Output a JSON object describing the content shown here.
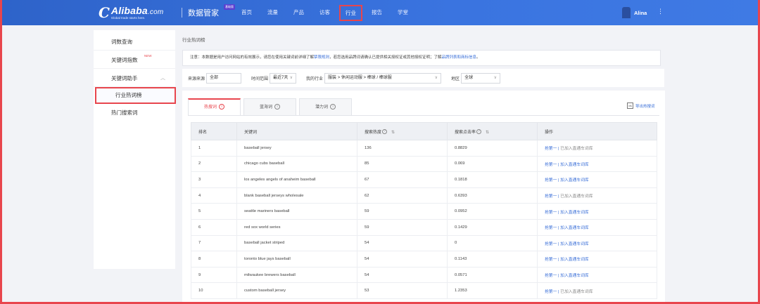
{
  "header": {
    "logo_mark": "C",
    "logo_word": "Alibaba",
    "logo_dotcom": ".com",
    "logo_tagline": "Global trade starts here.",
    "product": "数据管家",
    "product_badge": "基础版",
    "nav": [
      "首页",
      "流量",
      "产品",
      "访客",
      "行业",
      "报告",
      "学堂"
    ],
    "active_nav": "行业",
    "user_name": "Alina",
    "more_icon": "⋮"
  },
  "sidebar": {
    "items": [
      {
        "label": "词数查询"
      },
      {
        "label": "关键词指数",
        "badge": "NEW"
      },
      {
        "label": "关键词助手",
        "chevron": "︿"
      }
    ],
    "sub_items": [
      {
        "label": "行业热词榜",
        "active": true
      },
      {
        "label": "热门搜索词",
        "active": false
      }
    ]
  },
  "main": {
    "breadcrumb": "行业热词榜",
    "notice": {
      "text_before": "注意：本数据是用户访问网站的有效展示，请您在使用关键词前详细了解",
      "link1": "禁限规则",
      "text_middle": "，若您选用品牌词请确认已提供相关授权证或其他授权证明；了解",
      "link2": "品牌列表和商标信息",
      "text_after": "。"
    },
    "filters": {
      "source_label": "来源来源",
      "source_value": "全部",
      "time_label": "时间范围",
      "time_value": "最近7天",
      "industry_label": "我的行业",
      "industry_value": "服装 > 休闲运动服 > 棒球 / 棒球服",
      "region_label": "地区",
      "region_value": "全球",
      "caret": "∨"
    },
    "tabs": [
      {
        "label": "热搜词",
        "active": true
      },
      {
        "label": "蓝海词",
        "active": false
      },
      {
        "label": "潜力词",
        "active": false
      }
    ],
    "tab_info_icon": "i",
    "export_label": "导出热搜词",
    "export_icon": "xls",
    "table": {
      "headers": [
        "排名",
        "关键词",
        "搜索热度",
        "搜索点击率",
        "操作"
      ],
      "sort_icon": "⇅",
      "help_icon": "?",
      "rows": [
        {
          "rank": "1",
          "keyword": "baseball jersey",
          "heat": "136",
          "ctr": "0.8829",
          "op_link": "抢第一",
          "sep": " | ",
          "op2": "已加入直通车词库",
          "op2_gray": true
        },
        {
          "rank": "2",
          "keyword": "chicago cubs baseball",
          "heat": "85",
          "ctr": "0.069",
          "op_link": "抢第一",
          "sep": " | ",
          "op2": "加入直通车词库",
          "op2_gray": false
        },
        {
          "rank": "3",
          "keyword": "los angeles angels of anaheim baseball",
          "heat": "67",
          "ctr": "0.1818",
          "op_link": "抢第一",
          "sep": " | ",
          "op2": "加入直通车词库",
          "op2_gray": false
        },
        {
          "rank": "4",
          "keyword": "blank baseball jerseys wholesale",
          "heat": "62",
          "ctr": "0.6393",
          "op_link": "抢第一",
          "sep": " | ",
          "op2": "已加入直通车词库",
          "op2_gray": true
        },
        {
          "rank": "5",
          "keyword": "seattle mariners baseball",
          "heat": "59",
          "ctr": "0.0952",
          "op_link": "抢第一",
          "sep": " | ",
          "op2": "加入直通车词库",
          "op2_gray": false
        },
        {
          "rank": "6",
          "keyword": "red sox world series",
          "heat": "59",
          "ctr": "0.1429",
          "op_link": "抢第一",
          "sep": " | ",
          "op2": "加入直通车词库",
          "op2_gray": false
        },
        {
          "rank": "7",
          "keyword": "baseball jacket striped",
          "heat": "54",
          "ctr": "0",
          "op_link": "抢第一",
          "sep": " | ",
          "op2": "加入直通车词库",
          "op2_gray": false
        },
        {
          "rank": "8",
          "keyword": "toronto blue jays baseball",
          "heat": "54",
          "ctr": "0.1143",
          "op_link": "抢第一",
          "sep": " | ",
          "op2": "加入直通车词库",
          "op2_gray": false
        },
        {
          "rank": "9",
          "keyword": "milwaukee brewers baseball",
          "heat": "54",
          "ctr": "0.0571",
          "op_link": "抢第一",
          "sep": " | ",
          "op2": "加入直通车词库",
          "op2_gray": false
        },
        {
          "rank": "10",
          "keyword": "custom baseball jersey",
          "heat": "53",
          "ctr": "1.2353",
          "op_link": "抢第一",
          "sep": " | ",
          "op2": "已加入直通车词库",
          "op2_gray": true
        }
      ]
    }
  },
  "colors": {
    "accent": "#3a74e0",
    "highlight": "#e8454d",
    "link": "#3a6fd8"
  }
}
